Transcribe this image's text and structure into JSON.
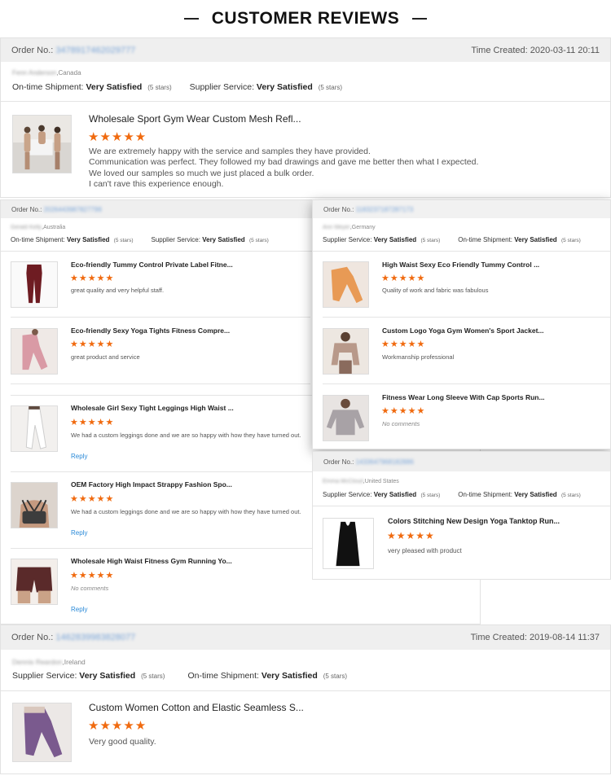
{
  "page_title": "CUSTOMER REVIEWS",
  "labels": {
    "order_no": "Order No.:",
    "time_created": "Time Created:",
    "on_time": "On-time Shipment:",
    "supplier": "Supplier Service:",
    "very_satisfied": "Very Satisfied",
    "five_stars": "(5 stars)",
    "reply": "Reply",
    "no_comments": "No comments",
    "stars": "★★★★★"
  },
  "review1": {
    "order_no": "3478917462029777",
    "time": "2020-03-11 20:11",
    "reviewer": "Fenn Anderson",
    "country": ",Canada",
    "item_title": "Wholesale Sport Gym Wear Custom Mesh Refl...",
    "comment_lines": [
      "We are extremely happy with the service and samples they have provided.",
      "Communication was perfect. They followed my bad drawings and gave me better then what I expected.",
      "We loved our samples so much we just placed a bulk order.",
      "I can't rave this experience enough."
    ]
  },
  "review2": {
    "order_no": "2026443987827799",
    "reviewer": "Gerald Kelly",
    "country": ",Australia",
    "items": [
      {
        "title": "Eco-friendly Tummy Control Private Label Fitne...",
        "comment": "great quality and very helpful staff."
      },
      {
        "title": "Eco-friendly Sexy Yoga Tights Fitness Compre...",
        "comment": "great product and service"
      },
      {
        "title": "Wholesale Girl Sexy Tight Leggings High Waist ...",
        "comment": "We had a custom leggings done and we are so happy with how they have turned out."
      },
      {
        "title": "OEM Factory High Impact Strappy Fashion Spo...",
        "comment": "We had a custom leggings done and we are so happy with how they have turned out."
      },
      {
        "title": "Wholesale High Waist Fitness Gym Running Yo...",
        "comment": "No comments"
      }
    ]
  },
  "review3": {
    "order_no": "1183237187287173",
    "reviewer": "Ann Meyer",
    "country": ",Germany",
    "items": [
      {
        "title": "High Waist Sexy Eco Friendly Tummy Control ...",
        "comment": "Quality of work and fabric was fabulous"
      },
      {
        "title": "Custom Logo Yoga Gym Women's Sport Jacket...",
        "comment": "Workmanship professional"
      },
      {
        "title": "Fitness Wear Long Sleeve With Cap Sports Run...",
        "comment": "No comments"
      }
    ]
  },
  "review4": {
    "order_no": "1433647968182886",
    "reviewer": "Emma McCloud",
    "country": ",United States",
    "item_title": "Colors Stitching New Design Yoga Tanktop Run...",
    "comment": "very pleased with product"
  },
  "review5": {
    "order_no": "1462839983828077",
    "time": "2019-08-14 11:37",
    "reviewer": "Dennis Reardon",
    "country": ",Ireland",
    "item_title": "Custom Women Cotton and Elastic Seamless S...",
    "comment": "Very good quality."
  },
  "colors": {
    "star": "#f06a0f",
    "link": "#2a8ad8",
    "order_no_blur": "#7aa5d8"
  }
}
